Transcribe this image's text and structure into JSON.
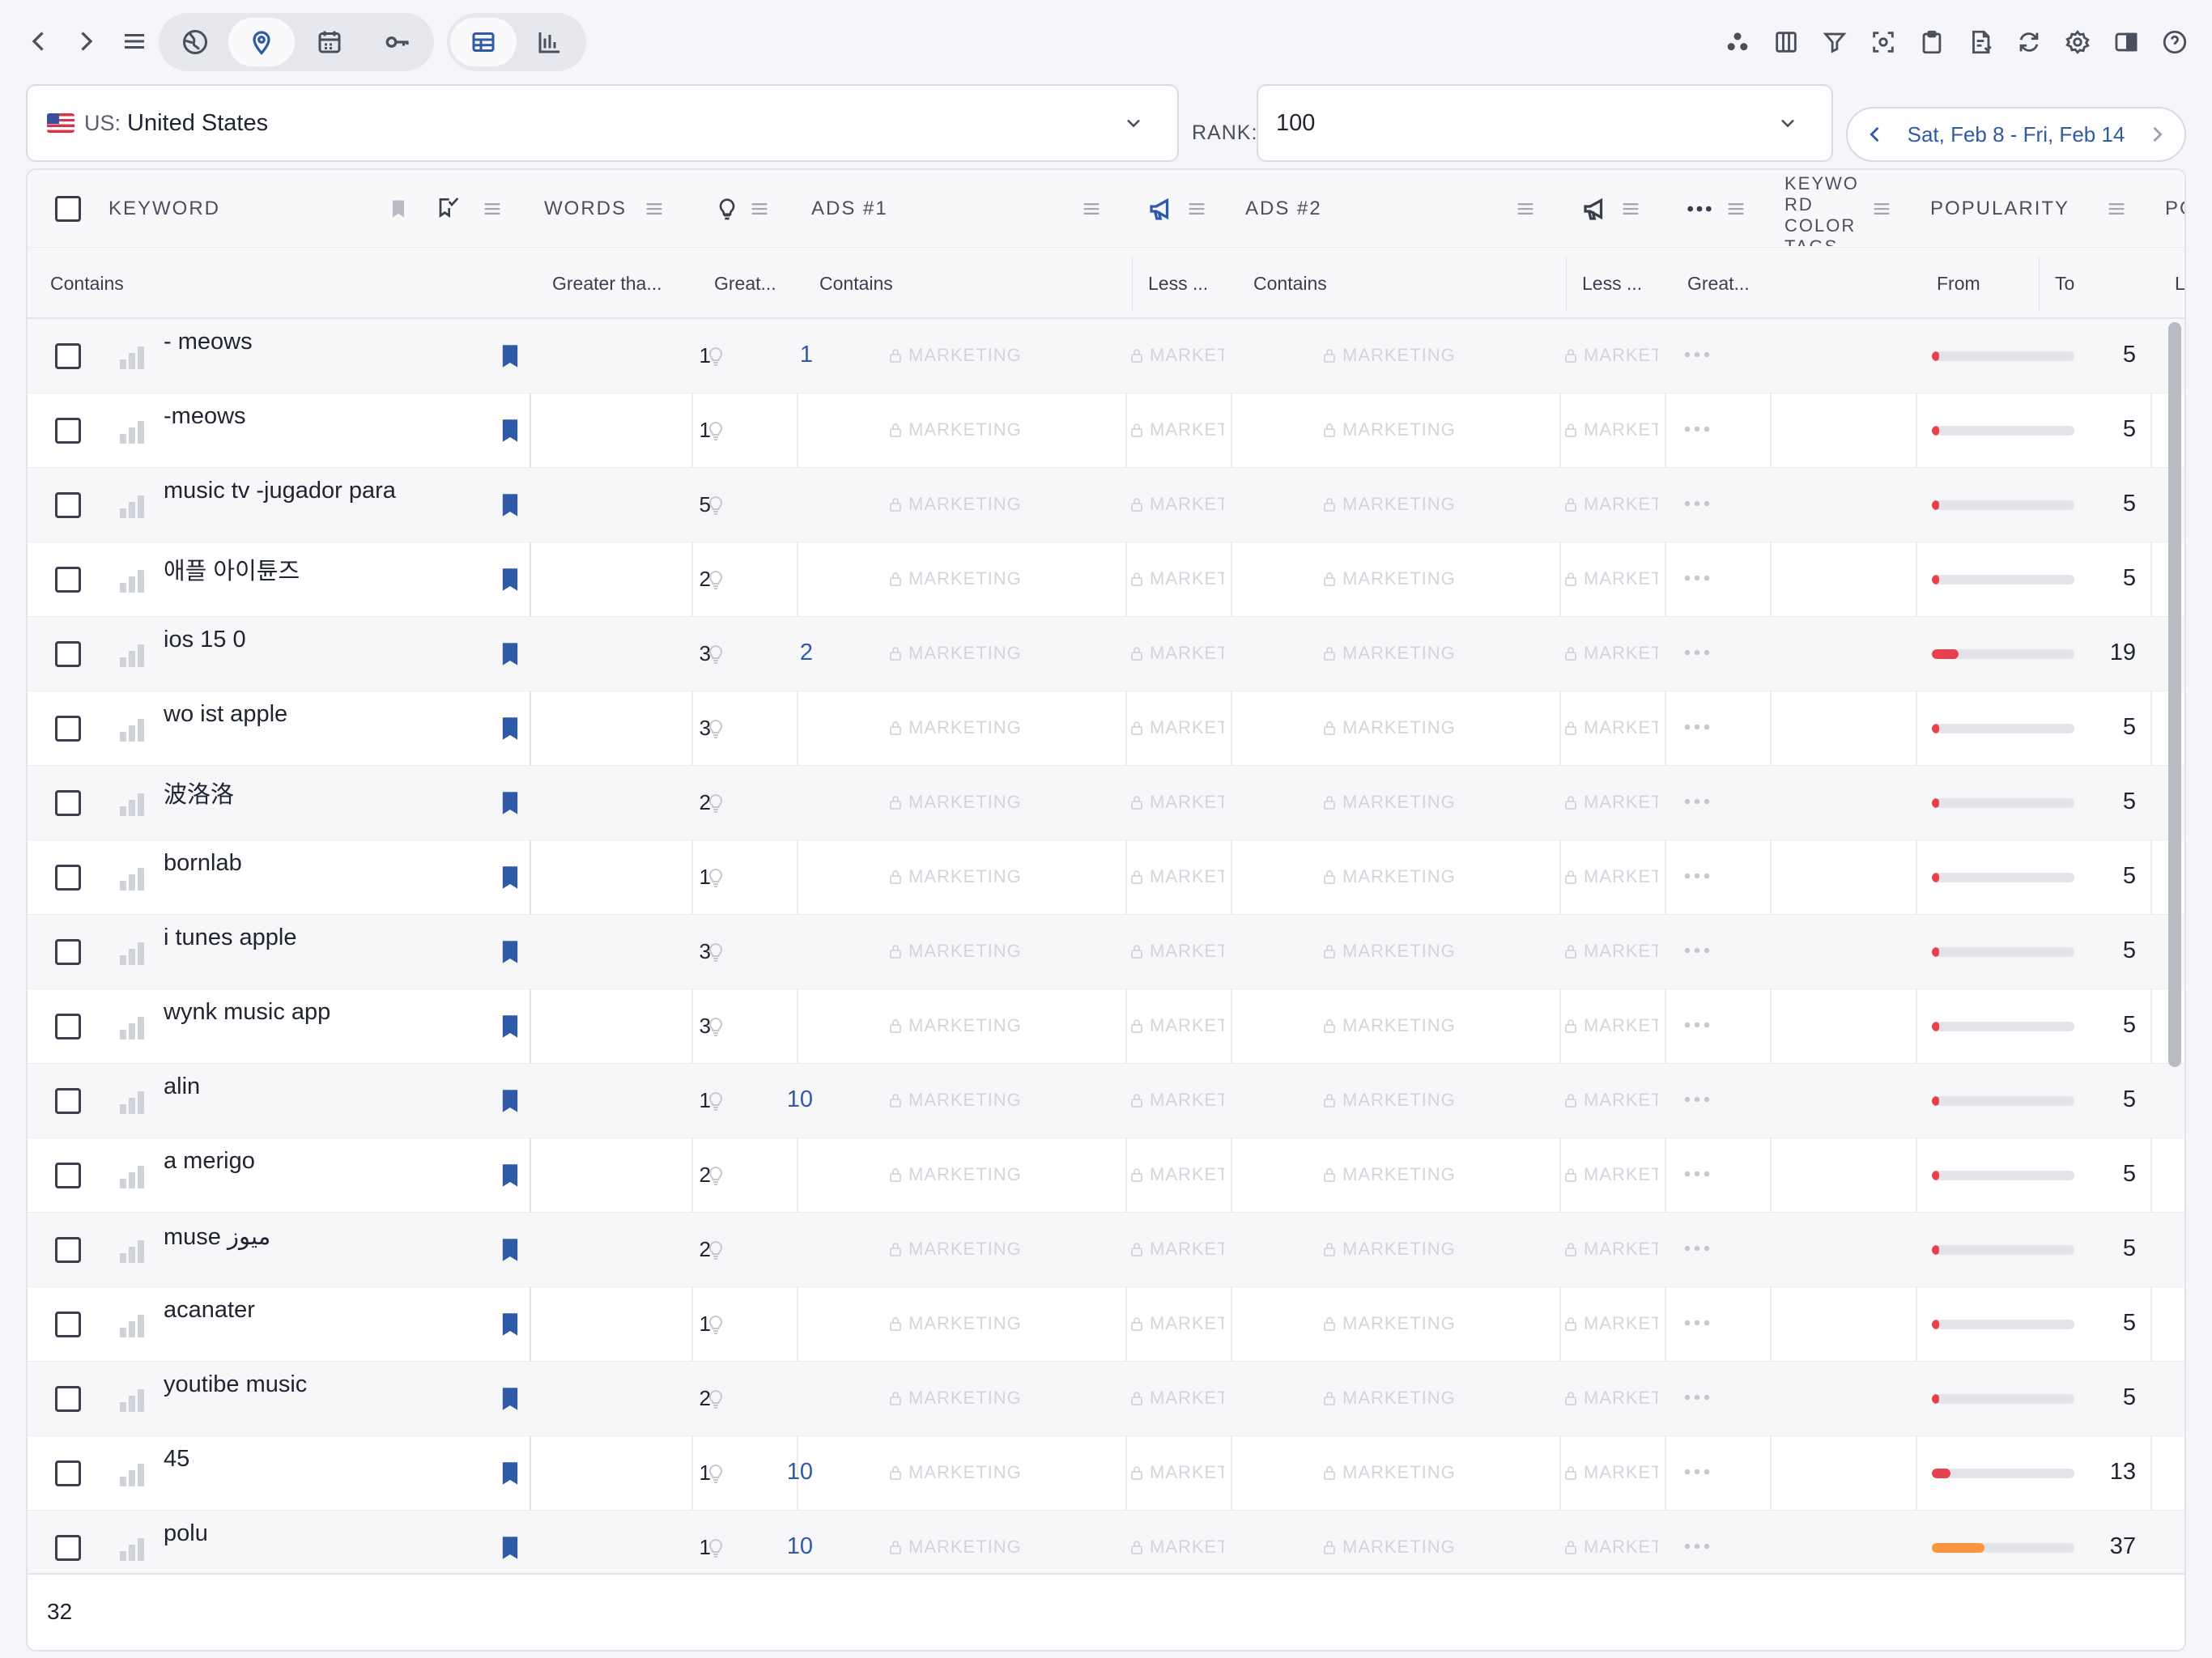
{
  "toolbar": {
    "back_icon": "chevron-left-icon",
    "forward_icon": "chevron-right-icon",
    "menu_icon": "hamburger-menu-icon",
    "mode_buttons": [
      "globe-icon",
      "map-pin-icon",
      "calendar-icon",
      "key-icon"
    ],
    "view_buttons": [
      "table-view-icon",
      "bar-chart-icon"
    ],
    "right_icons": [
      "dots-cluster-icon",
      "columns-icon",
      "filter-icon",
      "focus-icon",
      "clipboard-icon",
      "document-icon",
      "refresh-icon",
      "settings-icon",
      "panel-icon",
      "help-icon"
    ]
  },
  "filters": {
    "country_code": "US:",
    "country_name": "United States",
    "rank_label": "RANK:",
    "rank_value": "100",
    "date_range": "Sat, Feb 8 - Fri, Feb 14"
  },
  "columns": {
    "keyword": "KEYWORD",
    "words": "WORDS",
    "ads1": "ADS #1",
    "ads2": "ADS #2",
    "color_tags": "KEYWO RD COLOR TAGS",
    "popularity": "POPULARITY",
    "next": "PO"
  },
  "subheader": {
    "keyword": "Contains",
    "words": "Greater tha...",
    "suggest": "Great...",
    "ads1": "Contains",
    "ads1_b": "Less ...",
    "ads2": "Contains",
    "ads2_b": "Less ...",
    "more": "Great...",
    "pop_from": "From",
    "pop_to": "To",
    "next": "L"
  },
  "marketing_label": "MARKETING",
  "marketing_short": "MARKET",
  "rows": [
    {
      "keyword": "- meows",
      "words": "1",
      "suggest": "1",
      "popularity": 5
    },
    {
      "keyword": "-meows",
      "words": "1",
      "suggest": "",
      "popularity": 5
    },
    {
      "keyword": "music tv -jugador para",
      "words": "5",
      "suggest": "",
      "popularity": 5
    },
    {
      "keyword": "애플 아이튠즈",
      "words": "2",
      "suggest": "",
      "popularity": 5
    },
    {
      "keyword": "ios 15 0",
      "words": "3",
      "suggest": "2",
      "popularity": 19
    },
    {
      "keyword": "wo ist apple",
      "words": "3",
      "suggest": "",
      "popularity": 5
    },
    {
      "keyword": "波洛洛",
      "words": "2",
      "suggest": "",
      "popularity": 5
    },
    {
      "keyword": "bornlab",
      "words": "1",
      "suggest": "",
      "popularity": 5
    },
    {
      "keyword": "i tunes apple",
      "words": "3",
      "suggest": "",
      "popularity": 5
    },
    {
      "keyword": "wynk music app",
      "words": "3",
      "suggest": "",
      "popularity": 5
    },
    {
      "keyword": "alin",
      "words": "1",
      "suggest": "10",
      "popularity": 5
    },
    {
      "keyword": "a merigo",
      "words": "2",
      "suggest": "",
      "popularity": 5
    },
    {
      "keyword": "muse ميوز",
      "words": "2",
      "suggest": "",
      "popularity": 5
    },
    {
      "keyword": "acanater",
      "words": "1",
      "suggest": "",
      "popularity": 5
    },
    {
      "keyword": "youtibe music",
      "words": "2",
      "suggest": "",
      "popularity": 5
    },
    {
      "keyword": "45",
      "words": "1",
      "suggest": "10",
      "popularity": 13
    },
    {
      "keyword": "polu",
      "words": "1",
      "suggest": "10",
      "popularity": 37
    }
  ],
  "footer": {
    "count": "32"
  },
  "colors": {
    "accent": "#2f5aa8",
    "popularity_low": "#e8414e",
    "popularity_mid": "#f7963c",
    "track": "#e3e3e8"
  }
}
